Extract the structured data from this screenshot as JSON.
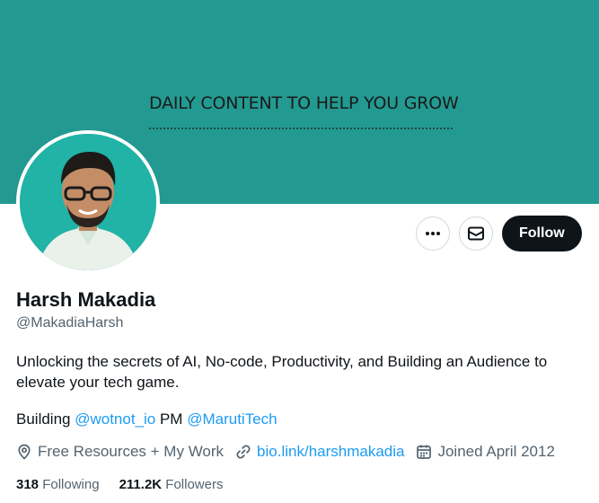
{
  "banner": {
    "text": "DAILY CONTENT TO HELP YOU GROW"
  },
  "actions": {
    "follow_label": "Follow"
  },
  "profile": {
    "name": "Harsh Makadia",
    "handle": "@MakadiaHarsh",
    "bio": "Unlocking the secrets of AI, No-code, Productivity, and Building an Audience to elevate your tech game.",
    "bio_line2": {
      "prefix": "Building ",
      "mention1": "@wotnot_io",
      "middle": " PM ",
      "mention2": "@MarutiTech"
    },
    "location": "Free Resources + My Work",
    "website": "bio.link/harshmakadia",
    "joined": "Joined April 2012"
  },
  "stats": {
    "following_count": "318",
    "following_label": "Following",
    "followers_count": "211.2K",
    "followers_label": "Followers"
  },
  "colors": {
    "banner": "#229a91",
    "avatar_bg": "#20b3a6",
    "link": "#1d9bf0",
    "follow_bg": "#0f1419"
  },
  "icons": [
    "more-icon",
    "mail-icon",
    "location-icon",
    "link-icon",
    "calendar-icon"
  ]
}
